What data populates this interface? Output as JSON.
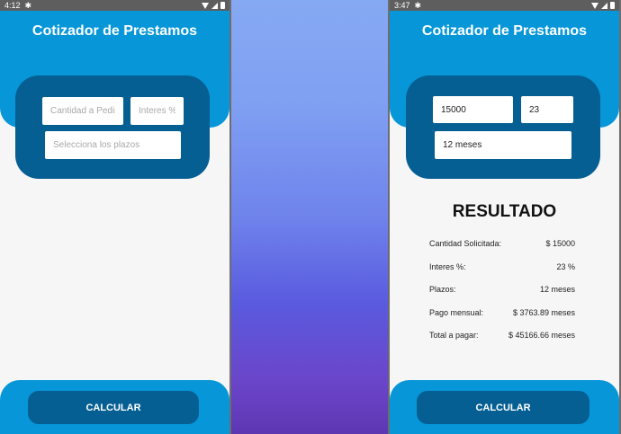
{
  "colors": {
    "primary": "#0796d8",
    "primary_dark": "#065f93",
    "background": "#f6f6f6",
    "status_bar": "#5e5e5e"
  },
  "left_screen": {
    "status": {
      "time": "4:12",
      "settings_icon": "gear-icon"
    },
    "title": "Cotizador de Prestamos",
    "form": {
      "amount_placeholder": "Cantidad a Pedir",
      "rate_placeholder": "Interes %",
      "terms_placeholder": "Selecciona los plazos"
    },
    "calculate_label": "CALCULAR"
  },
  "right_screen": {
    "status": {
      "time": "3:47",
      "settings_icon": "gear-icon"
    },
    "title": "Cotizador de Prestamos",
    "form": {
      "amount_value": "15000",
      "rate_value": "23",
      "terms_value": "12 meses"
    },
    "result": {
      "heading": "RESULTADO",
      "rows": [
        {
          "label": "Cantidad Solicitada:",
          "value": "$ 15000"
        },
        {
          "label": "Interes %:",
          "value": "23 %"
        },
        {
          "label": "Plazos:",
          "value": "12 meses"
        },
        {
          "label": "Pago mensual:",
          "value": "$ 3763.89 meses"
        },
        {
          "label": "Total a pagar:",
          "value": "$ 45166.66 meses"
        }
      ]
    },
    "calculate_label": "CALCULAR"
  }
}
